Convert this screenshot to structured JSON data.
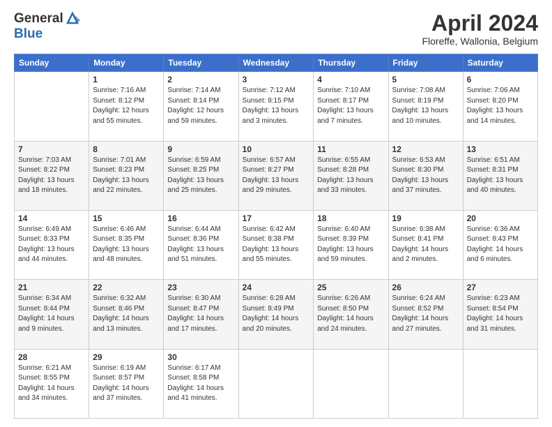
{
  "logo": {
    "line1": "General",
    "line2": "Blue"
  },
  "title": "April 2024",
  "subtitle": "Floreffe, Wallonia, Belgium",
  "days_of_week": [
    "Sunday",
    "Monday",
    "Tuesday",
    "Wednesday",
    "Thursday",
    "Friday",
    "Saturday"
  ],
  "weeks": [
    [
      {
        "num": "",
        "info": ""
      },
      {
        "num": "1",
        "info": "Sunrise: 7:16 AM\nSunset: 8:12 PM\nDaylight: 12 hours\nand 55 minutes."
      },
      {
        "num": "2",
        "info": "Sunrise: 7:14 AM\nSunset: 8:14 PM\nDaylight: 12 hours\nand 59 minutes."
      },
      {
        "num": "3",
        "info": "Sunrise: 7:12 AM\nSunset: 8:15 PM\nDaylight: 13 hours\nand 3 minutes."
      },
      {
        "num": "4",
        "info": "Sunrise: 7:10 AM\nSunset: 8:17 PM\nDaylight: 13 hours\nand 7 minutes."
      },
      {
        "num": "5",
        "info": "Sunrise: 7:08 AM\nSunset: 8:19 PM\nDaylight: 13 hours\nand 10 minutes."
      },
      {
        "num": "6",
        "info": "Sunrise: 7:06 AM\nSunset: 8:20 PM\nDaylight: 13 hours\nand 14 minutes."
      }
    ],
    [
      {
        "num": "7",
        "info": "Sunrise: 7:03 AM\nSunset: 8:22 PM\nDaylight: 13 hours\nand 18 minutes."
      },
      {
        "num": "8",
        "info": "Sunrise: 7:01 AM\nSunset: 8:23 PM\nDaylight: 13 hours\nand 22 minutes."
      },
      {
        "num": "9",
        "info": "Sunrise: 6:59 AM\nSunset: 8:25 PM\nDaylight: 13 hours\nand 25 minutes."
      },
      {
        "num": "10",
        "info": "Sunrise: 6:57 AM\nSunset: 8:27 PM\nDaylight: 13 hours\nand 29 minutes."
      },
      {
        "num": "11",
        "info": "Sunrise: 6:55 AM\nSunset: 8:28 PM\nDaylight: 13 hours\nand 33 minutes."
      },
      {
        "num": "12",
        "info": "Sunrise: 6:53 AM\nSunset: 8:30 PM\nDaylight: 13 hours\nand 37 minutes."
      },
      {
        "num": "13",
        "info": "Sunrise: 6:51 AM\nSunset: 8:31 PM\nDaylight: 13 hours\nand 40 minutes."
      }
    ],
    [
      {
        "num": "14",
        "info": "Sunrise: 6:49 AM\nSunset: 8:33 PM\nDaylight: 13 hours\nand 44 minutes."
      },
      {
        "num": "15",
        "info": "Sunrise: 6:46 AM\nSunset: 8:35 PM\nDaylight: 13 hours\nand 48 minutes."
      },
      {
        "num": "16",
        "info": "Sunrise: 6:44 AM\nSunset: 8:36 PM\nDaylight: 13 hours\nand 51 minutes."
      },
      {
        "num": "17",
        "info": "Sunrise: 6:42 AM\nSunset: 8:38 PM\nDaylight: 13 hours\nand 55 minutes."
      },
      {
        "num": "18",
        "info": "Sunrise: 6:40 AM\nSunset: 8:39 PM\nDaylight: 13 hours\nand 59 minutes."
      },
      {
        "num": "19",
        "info": "Sunrise: 6:38 AM\nSunset: 8:41 PM\nDaylight: 14 hours\nand 2 minutes."
      },
      {
        "num": "20",
        "info": "Sunrise: 6:36 AM\nSunset: 8:43 PM\nDaylight: 14 hours\nand 6 minutes."
      }
    ],
    [
      {
        "num": "21",
        "info": "Sunrise: 6:34 AM\nSunset: 8:44 PM\nDaylight: 14 hours\nand 9 minutes."
      },
      {
        "num": "22",
        "info": "Sunrise: 6:32 AM\nSunset: 8:46 PM\nDaylight: 14 hours\nand 13 minutes."
      },
      {
        "num": "23",
        "info": "Sunrise: 6:30 AM\nSunset: 8:47 PM\nDaylight: 14 hours\nand 17 minutes."
      },
      {
        "num": "24",
        "info": "Sunrise: 6:28 AM\nSunset: 8:49 PM\nDaylight: 14 hours\nand 20 minutes."
      },
      {
        "num": "25",
        "info": "Sunrise: 6:26 AM\nSunset: 8:50 PM\nDaylight: 14 hours\nand 24 minutes."
      },
      {
        "num": "26",
        "info": "Sunrise: 6:24 AM\nSunset: 8:52 PM\nDaylight: 14 hours\nand 27 minutes."
      },
      {
        "num": "27",
        "info": "Sunrise: 6:23 AM\nSunset: 8:54 PM\nDaylight: 14 hours\nand 31 minutes."
      }
    ],
    [
      {
        "num": "28",
        "info": "Sunrise: 6:21 AM\nSunset: 8:55 PM\nDaylight: 14 hours\nand 34 minutes."
      },
      {
        "num": "29",
        "info": "Sunrise: 6:19 AM\nSunset: 8:57 PM\nDaylight: 14 hours\nand 37 minutes."
      },
      {
        "num": "30",
        "info": "Sunrise: 6:17 AM\nSunset: 8:58 PM\nDaylight: 14 hours\nand 41 minutes."
      },
      {
        "num": "",
        "info": ""
      },
      {
        "num": "",
        "info": ""
      },
      {
        "num": "",
        "info": ""
      },
      {
        "num": "",
        "info": ""
      }
    ]
  ]
}
